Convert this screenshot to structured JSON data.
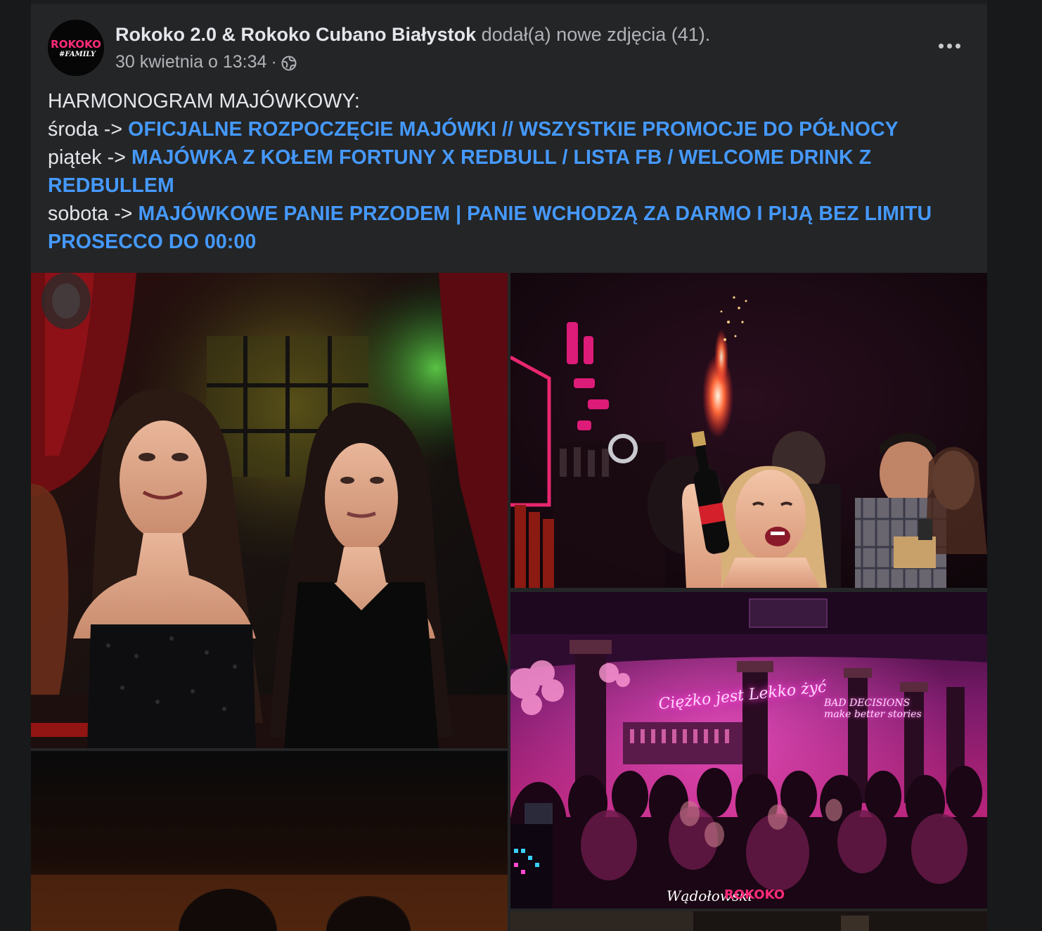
{
  "post": {
    "author": "Rokoko 2.0 & Rokoko Cubano Białystok",
    "action": "dodał(a) nowe zdjęcia (41).",
    "timestamp": "30 kwietnia o 13:34",
    "separator": "·",
    "privacy_icon": "globe-icon",
    "avatar_text_top": "ROKOKO",
    "avatar_text_bottom": "#FAMILY",
    "more_icon": "more-options-icon",
    "text": {
      "heading": "HARMONOGRAM MAJÓWKOWY:",
      "lines": [
        {
          "prefix": "środa -> ",
          "highlight": "OFICJALNE ROZPOCZĘCIE MAJÓWKI // WSZYSTKIE PROMOCJE DO PÓŁNOCY"
        },
        {
          "prefix": "piątek -> ",
          "highlight": "MAJÓWKA Z KOŁEM FORTUNY X REDBULL / LISTA FB / WELCOME DRINK Z REDBULLEM"
        },
        {
          "prefix": "sobota -> ",
          "highlight": "MAJÓWKOWE PANIE PRZODEM | PANIE WCHODZĄ ZA DARMO I PIJĄ BEZ LIMITU PROSECCO DO 00:00"
        }
      ]
    }
  },
  "photos": {
    "p3_neon_main": "Ciężko jest Lekko żyć",
    "p3_neon_side_1": "BAD DECISIONS",
    "p3_neon_side_2": "make better stories",
    "p3_watermark": "Wądołowski",
    "p3_watermark_brand": "ROKOKO"
  },
  "colors": {
    "background": "#18191a",
    "card": "#242526",
    "primary_text": "#e4e6eb",
    "secondary_text": "#b0b3b8",
    "link": "#4599ff",
    "brand_pink": "#ff2a7a"
  }
}
